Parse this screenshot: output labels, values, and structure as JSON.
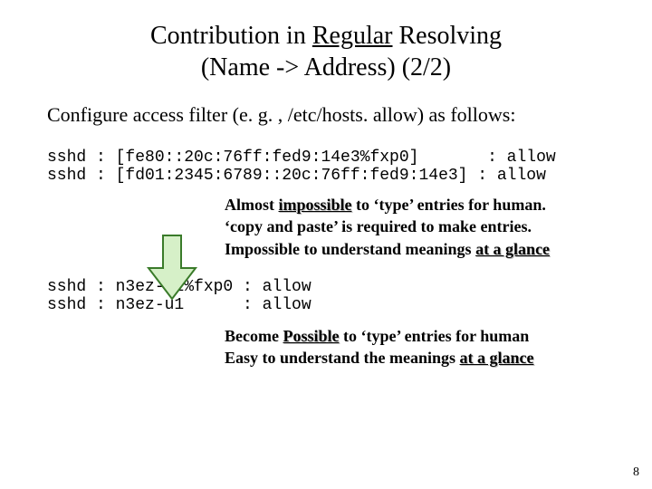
{
  "title": {
    "line1_pre": "Contribution in ",
    "line1_u": "Regular",
    "line1_post": " Resolving",
    "line2": "(Name -> Address)  (2/2)"
  },
  "intro": "Configure access filter (e. g. , /etc/hosts. allow) as follows:",
  "code1": {
    "l1": "sshd : [fe80::20c:76ff:fed9:14e3%fxp0]       : allow",
    "l2": "sshd : [fd01:2345:6789::20c:76ff:fed9:14e3] : allow"
  },
  "note1": {
    "l1a": "Almost ",
    "l1b": "impossible",
    "l1c": " to ‘type’ entries for human.",
    "l2": "‘copy and paste’ is required to make entries.",
    "l3a": "Impossible to understand meanings ",
    "l3b": "at a glance"
  },
  "code2": {
    "l1": "sshd : n3ez-l1%fxp0 : allow",
    "l2": "sshd : n3ez-u1      : allow"
  },
  "note2": {
    "l1a": "Become ",
    "l1b": "Possible",
    "l1c": " to ‘type’ entries for human",
    "l2a": "Easy to understand the meanings ",
    "l2b": "at a glance"
  },
  "page_number": "8"
}
